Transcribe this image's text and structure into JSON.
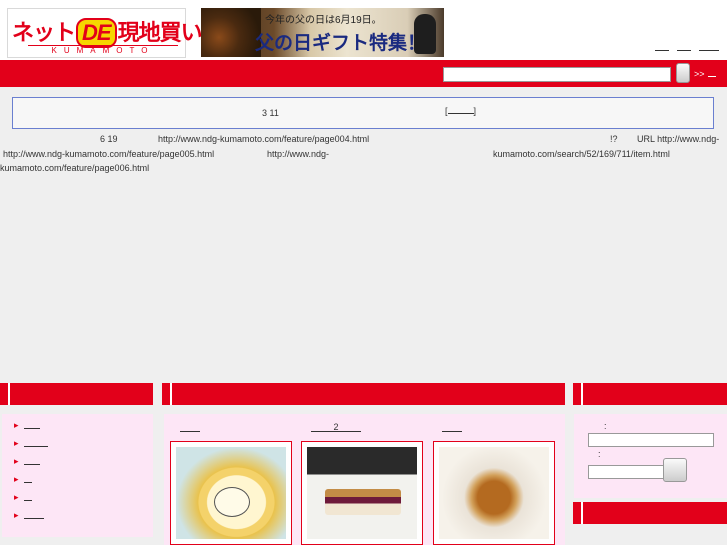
{
  "header": {
    "logo_main": "ネット",
    "logo_de": "DE",
    "logo_main2": "現地買い!",
    "logo_sub": "KUMAMOTO",
    "banner_top": "今年の父の日は6月19日。",
    "banner_main": "父の日ギフト特集！",
    "links": [
      "",
      "",
      ""
    ]
  },
  "search": {
    "placeholder": "",
    "advanced_label": ">>"
  },
  "notice": {
    "text": "3 11",
    "link_open": "[",
    "link_close": "]"
  },
  "intro": {
    "l1a": "6 19",
    "l1b": "http://www.ndg-kumamoto.com/feature/page004.html",
    "l1c": "!?",
    "l1d": "URL http://www.ndg-",
    "l2a": "http://www.ndg-kumamoto.com/feature/page005.html",
    "l2b": "http://www.ndg-",
    "l2c": "kumamoto.com/search/52/169/711/item.html",
    "l3a": "kumamoto.com/feature/page006.html"
  },
  "products": {
    "tab_link_mid": "2",
    "items": [
      {
        "image": "roll-cake-panda"
      },
      {
        "image": "sandwich-cake"
      },
      {
        "image": "fried-bread"
      }
    ]
  },
  "search_box": {
    "label1": ":",
    "label2": ":"
  },
  "colors": {
    "accent_red": "#e2001a",
    "panel_pink": "#fde6f6",
    "notice_border": "#6a7fd0"
  }
}
